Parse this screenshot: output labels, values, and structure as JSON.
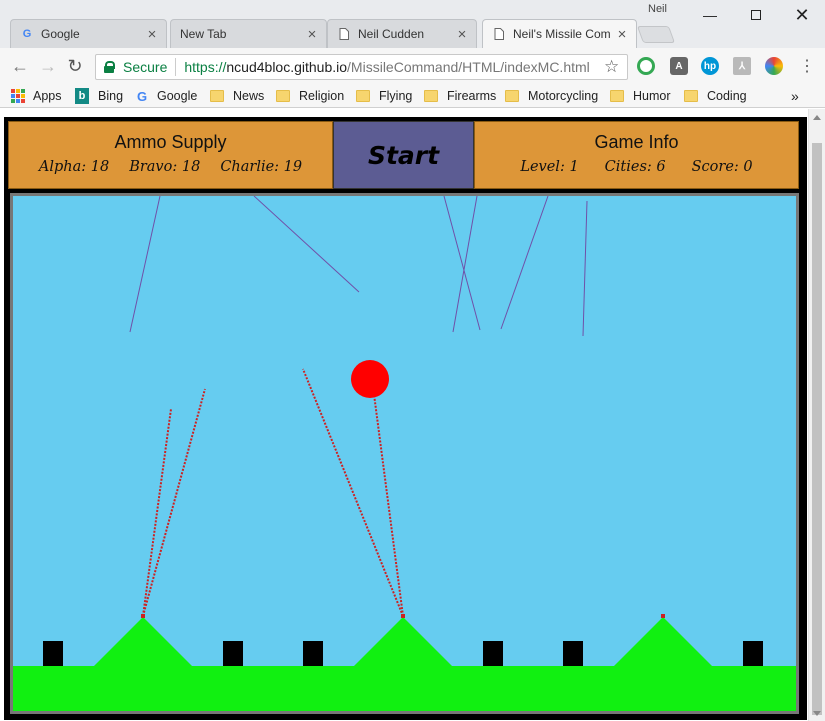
{
  "browser": {
    "user_name": "Neil",
    "tabs": [
      {
        "label": "Google",
        "icon": "google-icon"
      },
      {
        "label": "New Tab",
        "icon": ""
      },
      {
        "label": "Neil Cudden",
        "icon": "page-icon"
      },
      {
        "label": "Neil's Missile Com",
        "icon": "page-icon"
      }
    ],
    "security_label": "Secure",
    "url_scheme": "https://",
    "url_host": "ncud4bloc.github.io",
    "url_path": "/MissileCommand/HTML/indexMC.html",
    "bookmarks": [
      {
        "label": "Apps",
        "icon": "apps-grid-icon"
      },
      {
        "label": "Bing",
        "icon": "bing-icon"
      },
      {
        "label": "Google",
        "icon": "google-icon"
      },
      {
        "label": "News",
        "icon": "folder-icon"
      },
      {
        "label": "Religion",
        "icon": "folder-icon"
      },
      {
        "label": "Flying",
        "icon": "folder-icon"
      },
      {
        "label": "Firearms",
        "icon": "folder-icon"
      },
      {
        "label": "Motorcycling",
        "icon": "folder-icon"
      },
      {
        "label": "Humor",
        "icon": "folder-icon"
      },
      {
        "label": "Coding",
        "icon": "folder-icon"
      }
    ],
    "overflow_label": "»"
  },
  "game": {
    "ammo": {
      "title": "Ammo Supply",
      "alpha": "Alpha: 18",
      "bravo": "Bravo: 18",
      "charlie": "Charlie: 19"
    },
    "start_label": "Start",
    "info": {
      "title": "Game Info",
      "level": "Level: 1",
      "cities": "Cities: 6",
      "score": "Score: 0"
    },
    "colors": {
      "sky": "#66ccf0",
      "ground": "#11f011",
      "explosion": "#ff0000",
      "enemy_trail": "#7050a8",
      "defense_trail": "#cc2222",
      "city": "#000000",
      "panel": "#dd9638",
      "start_button": "#5c5c93"
    }
  }
}
